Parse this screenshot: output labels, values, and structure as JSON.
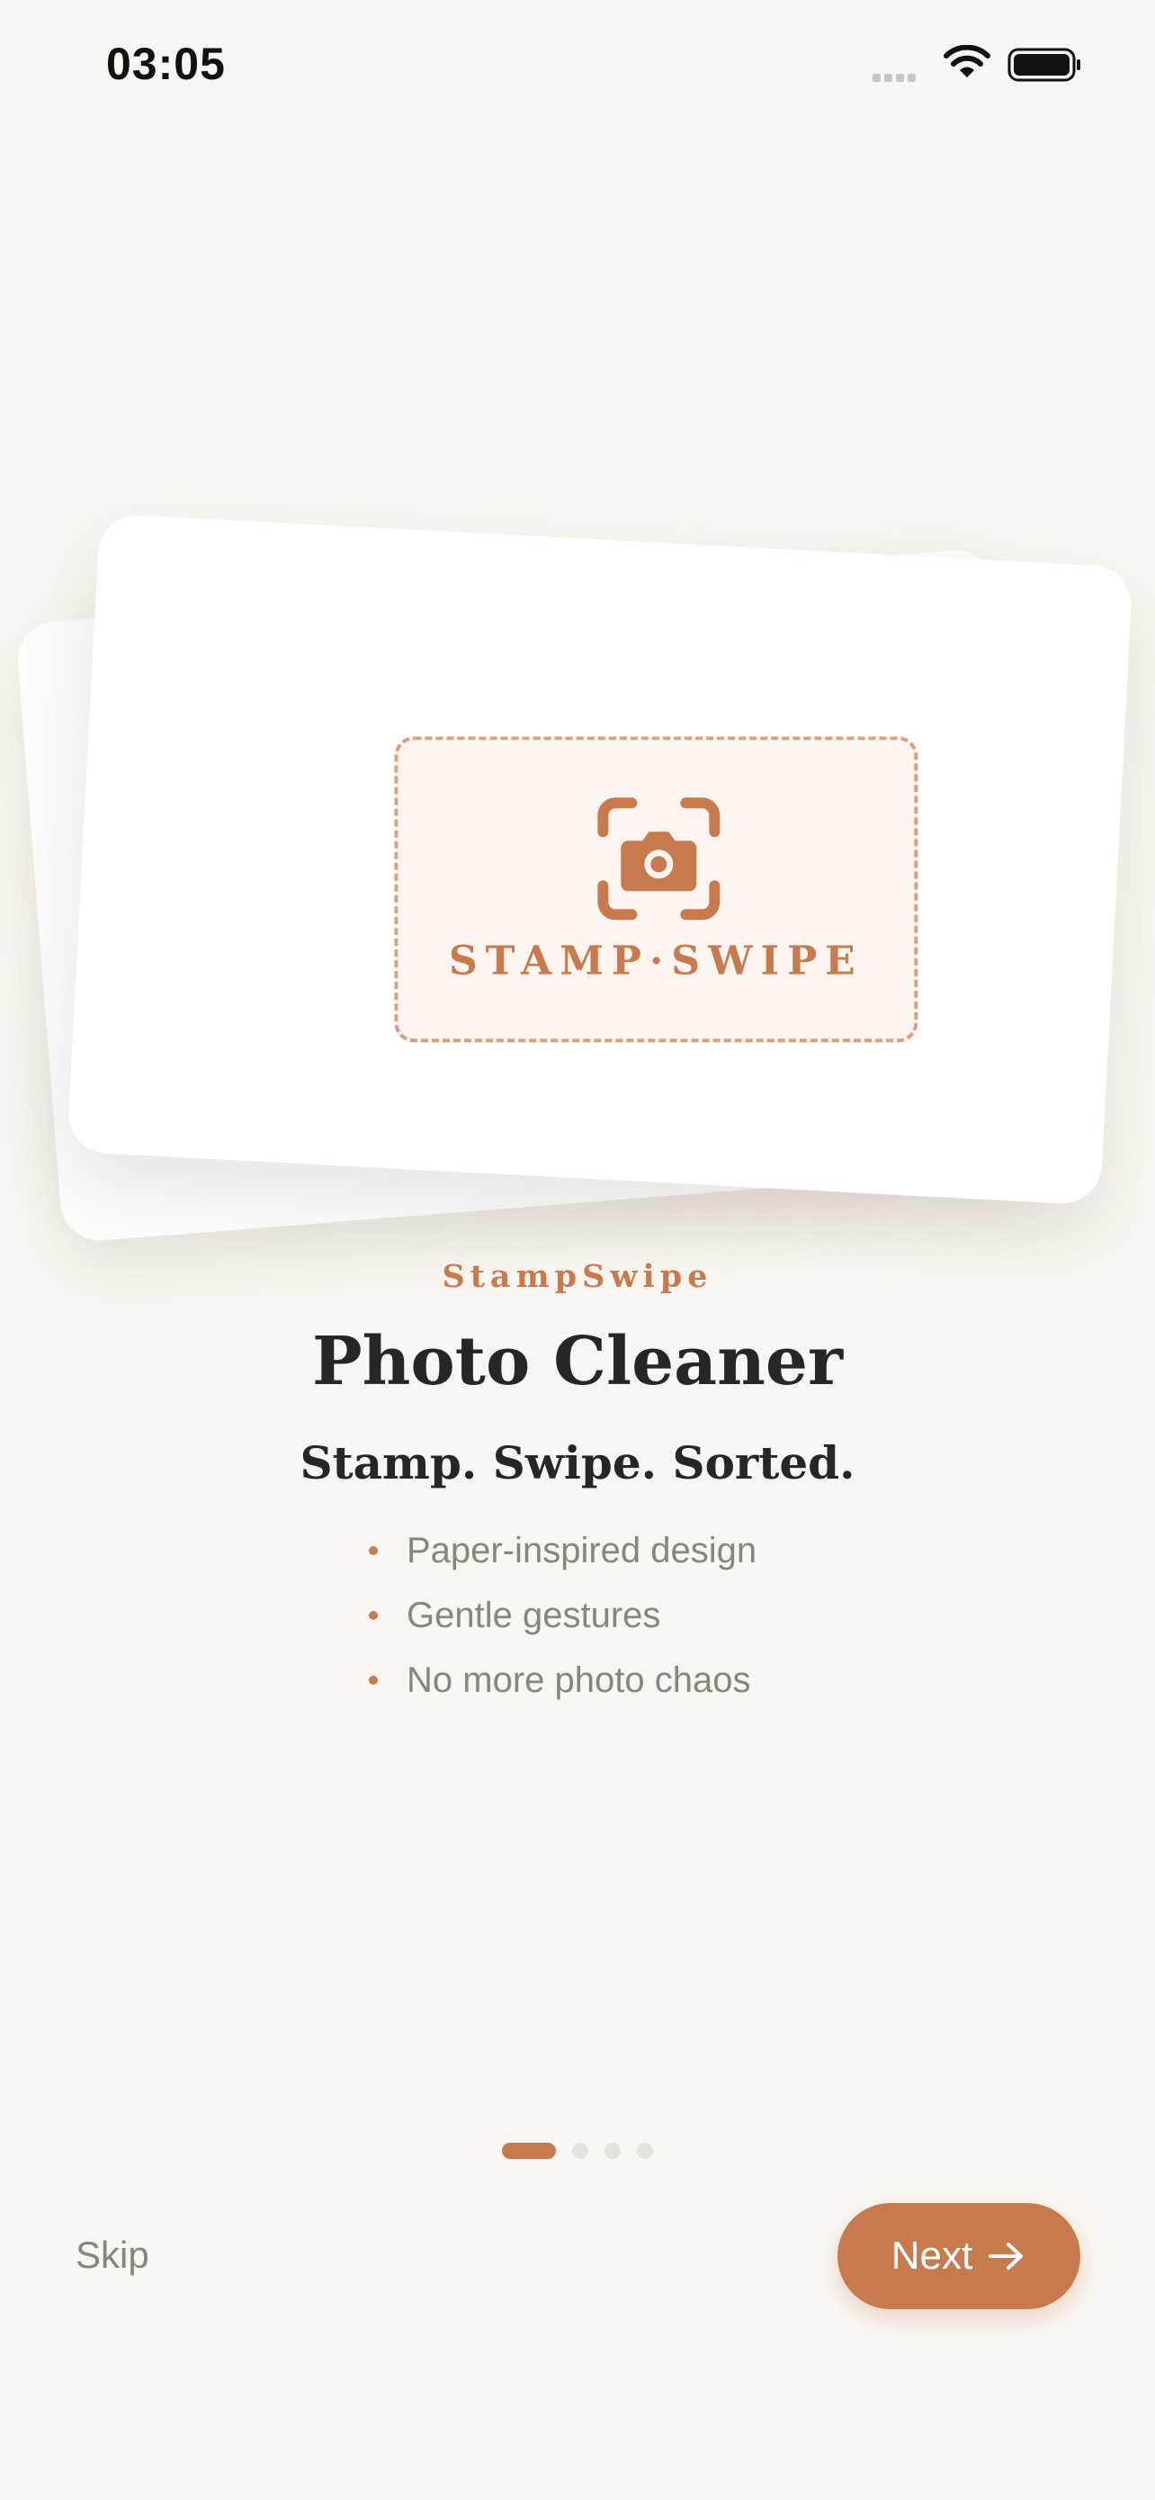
{
  "status_bar": {
    "time": "03:05"
  },
  "hero": {
    "stamp_text": "STAMP·SWIPE"
  },
  "content": {
    "brand": "StampSwipe",
    "title": "Photo Cleaner",
    "subtitle": "Stamp. Swipe. Sorted.",
    "features": [
      "Paper-inspired design",
      "Gentle gestures",
      "No more photo chaos"
    ]
  },
  "pager": {
    "total": 4,
    "current": 1
  },
  "actions": {
    "skip_label": "Skip",
    "next_label": "Next"
  },
  "icons": {
    "stamp": "camera-viewfinder-icon",
    "next": "arrow-right-icon",
    "wifi": "wifi-icon",
    "battery": "battery-icon",
    "signal": "signal-icon"
  },
  "colors": {
    "accent": "#c77a4e",
    "background": "#f9f6f1",
    "text": "#2a2522",
    "muted": "#8a847d"
  }
}
